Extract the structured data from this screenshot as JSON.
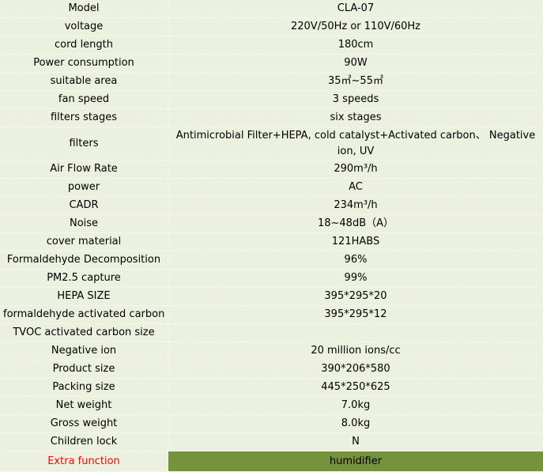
{
  "spec_table": {
    "rows": [
      {
        "label": "Model",
        "value": "CLA-07"
      },
      {
        "label": "voltage",
        "value": "220V/50Hz or 110V/60Hz"
      },
      {
        "label": "cord length",
        "value": "180cm"
      },
      {
        "label": "Power consumption",
        "value": "90W"
      },
      {
        "label": "suitable area",
        "value": "35㎡~55㎡"
      },
      {
        "label": "fan speed",
        "value": "3 speeds"
      },
      {
        "label": "filters stages",
        "value": "six stages"
      },
      {
        "label": "filters",
        "value": "Antimicrobial Filter+HEPA, cold catalyst+Activated carbon、 Negative ion, UV"
      },
      {
        "label": "Air Flow Rate",
        "value": "290m³/h"
      },
      {
        "label": "power",
        "value": "AC"
      },
      {
        "label": "CADR",
        "value": "234m³/h"
      },
      {
        "label": "Noise",
        "value": "18~48dB（A）"
      },
      {
        "label": "cover material",
        "value": "121HABS"
      },
      {
        "label": "Formaldehyde Decomposition",
        "value": "96%"
      },
      {
        "label": "PM2.5 capture",
        "value": "99%"
      },
      {
        "label": "HEPA SIZE",
        "value": "395*295*20"
      },
      {
        "label": "formaldehyde activated carbon",
        "value": "395*295*12"
      },
      {
        "label": "TVOC activated carbon size",
        "value": ""
      },
      {
        "label": "Negative ion",
        "value": "20 million ions/cc"
      },
      {
        "label": "Product size",
        "value": "390*206*580"
      },
      {
        "label": "Packing size",
        "value": "445*250*625"
      },
      {
        "label": "Net weight",
        "value": "7.0kg"
      },
      {
        "label": "Gross weight",
        "value": "8.0kg"
      },
      {
        "label": "Children lock",
        "value": "N"
      },
      {
        "label": "Extra function",
        "value": "humidifier"
      }
    ]
  },
  "colors": {
    "cell_background": "#ebf1de",
    "highlight_background": "#76923c",
    "highlight_label_text": "#ff0000"
  }
}
